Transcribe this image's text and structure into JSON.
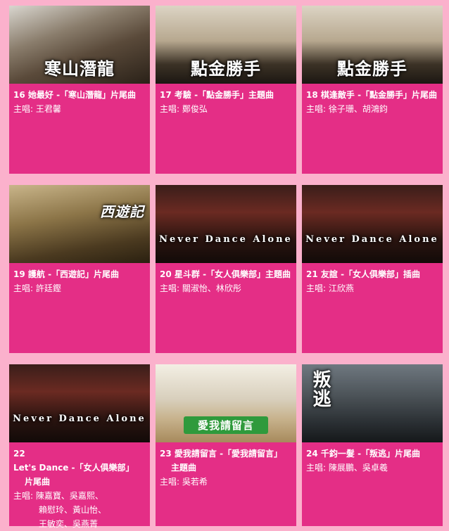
{
  "songs": [
    {
      "num": "16",
      "title": "她最好 -「寒山潛龍」片尾曲",
      "singer_label": "主唱:",
      "singers": "王君馨",
      "logo": "寒山潛龍"
    },
    {
      "num": "17",
      "title": "考驗 -「點金勝手」主題曲",
      "singer_label": "主唱:",
      "singers": "鄭俊弘",
      "logo": "點金勝手"
    },
    {
      "num": "18",
      "title": "棋逢敵手 -「點金勝手」片尾曲",
      "singer_label": "主唱:",
      "singers": "徐子珊、胡鴻鈞",
      "logo": "點金勝手"
    },
    {
      "num": "19",
      "title": "護航 -「西遊記」片尾曲",
      "singer_label": "主唱:",
      "singers": "許廷鏗",
      "logo": "西遊記"
    },
    {
      "num": "20",
      "title": "星斗群 -「女人俱樂部」主題曲",
      "singer_label": "主唱:",
      "singers": "關淑怡、林欣彤",
      "logo": "Never Dance Alone"
    },
    {
      "num": "21",
      "title": "友誼 -「女人俱樂部」插曲",
      "singer_label": "主唱:",
      "singers": "江欣燕",
      "logo": "Never Dance Alone"
    },
    {
      "num": "22",
      "title_line1": "Let's Dance -「女人俱樂部」",
      "title_line2": "片尾曲",
      "singer_label": "主唱:",
      "singers_line1": "陳嘉寶、吳嘉熙、",
      "singers_line2": "賴慰玲、黃山怡、",
      "singers_line3": "王敏奕、吳燕菁",
      "logo": "Never Dance Alone"
    },
    {
      "num": "23",
      "title_line1": "愛我請留言 -「愛我請留言」",
      "title_line2": "主題曲",
      "singer_label": "主唱:",
      "singers": "吳若希",
      "logo": "愛我請留言"
    },
    {
      "num": "24",
      "title": "千鈞一髮 -「叛逃」片尾曲",
      "singer_label": "主唱:",
      "singers": "陳展鵬、吳卓羲",
      "logo": "叛逃"
    }
  ],
  "colors": {
    "page_bg": "#fbb1cc",
    "card_bg": "#e42e86",
    "text": "#ffffff"
  }
}
